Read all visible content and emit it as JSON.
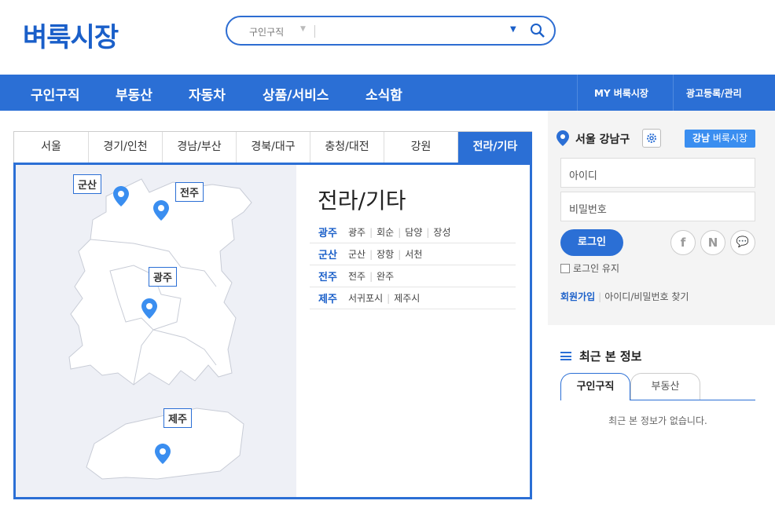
{
  "header": {
    "logo": "벼룩시장",
    "search": {
      "category": "구인구직",
      "value": "",
      "placeholder": ""
    }
  },
  "nav": {
    "items": [
      "구인구직",
      "부동산",
      "자동차",
      "상품/서비스",
      "소식함"
    ],
    "right": [
      "MY 벼룩시장",
      "광고등록/관리"
    ]
  },
  "region_tabs": [
    "서울",
    "경기/인천",
    "경남/부산",
    "경북/대구",
    "충청/대전",
    "강원",
    "전라/기타"
  ],
  "map": {
    "labels": [
      "군산",
      "전주",
      "광주",
      "제주"
    ]
  },
  "region": {
    "title": "전라/기타",
    "rows": [
      {
        "city": "광주",
        "subs": [
          "광주",
          "회순",
          "담양",
          "장성"
        ]
      },
      {
        "city": "군산",
        "subs": [
          "군산",
          "장항",
          "서천"
        ]
      },
      {
        "city": "전주",
        "subs": [
          "전주",
          "완주"
        ]
      },
      {
        "city": "제주",
        "subs": [
          "서귀포시",
          "제주시"
        ]
      }
    ]
  },
  "side": {
    "location": "서울 강남구",
    "local_btn_bold": "강남",
    "local_btn_rest": " 벼룩시장",
    "id_placeholder": "아이디",
    "pw_placeholder": "비밀번호",
    "login": "로그인",
    "keep_login": "로그인 유지",
    "join": "회원가입",
    "find": "아이디/비밀번호 찾기",
    "social": [
      "f",
      "N",
      "💬"
    ]
  },
  "recent": {
    "title": "최근 본 정보",
    "tabs": [
      "구인구직",
      "부동산"
    ],
    "empty": "최근 본 정보가 없습니다."
  },
  "colors": {
    "brand": "#2b6fd5",
    "pin": "#3a8ef0"
  }
}
